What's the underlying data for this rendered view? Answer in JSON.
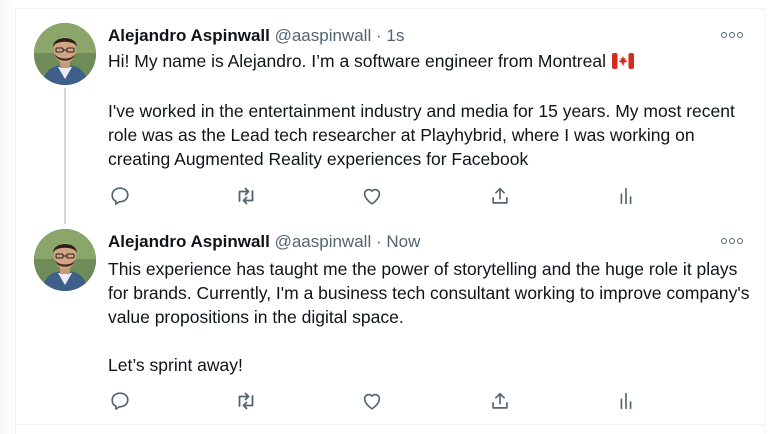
{
  "tweets": [
    {
      "author_name": "Alejandro Aspinwall",
      "handle": "@aaspinwall",
      "separator": "·",
      "time": "1s",
      "paragraphs": [
        "Hi! My name is Alejandro. I’m a software engineer from Montreal",
        "I've worked in the entertainment industry and media for 15 years. My most recent role was as the Lead tech researcher at Playhybrid, where I was working on creating Augmented Reality experiences for Facebook"
      ],
      "emoji": "canada-flag"
    },
    {
      "author_name": "Alejandro Aspinwall",
      "handle": "@aaspinwall",
      "separator": "·",
      "time": "Now",
      "paragraphs": [
        "This experience has taught me the power of storytelling and the huge role it plays for brands. Currently, I'm a business tech consultant working to improve company's value propositions in the digital space.",
        "Let’s sprint away!"
      ]
    }
  ],
  "icons": {
    "reply": "reply-bubble-icon",
    "retweet": "retweet-arrows-icon",
    "like": "heart-icon",
    "share": "share-upload-icon",
    "analytics": "analytics-bars-icon",
    "more": "more-dots-icon"
  },
  "colors": {
    "text": "#0f1419",
    "secondary": "#536471",
    "thread_line": "#cfd9de",
    "divider": "#eff3f4"
  }
}
